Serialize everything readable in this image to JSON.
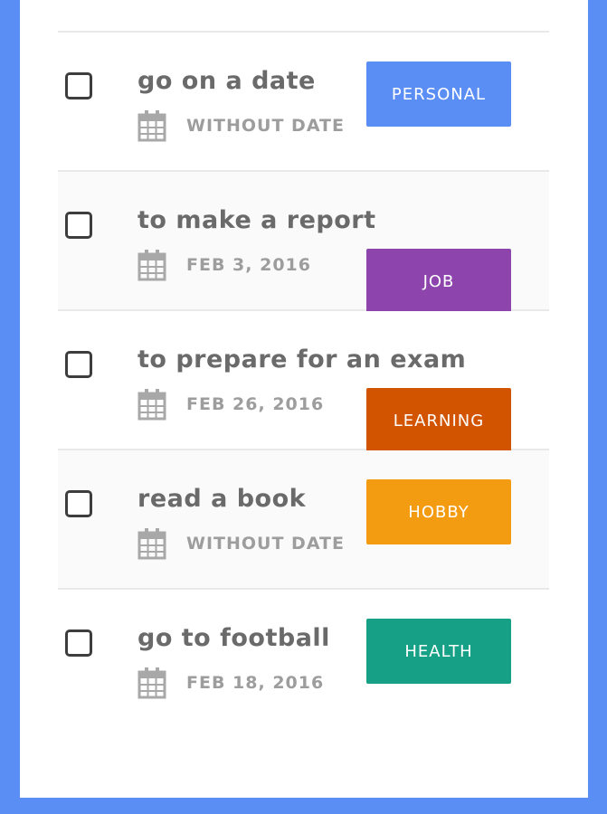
{
  "todos": [
    {
      "title": "go on a date",
      "date": "WITHOUT DATE",
      "tag": "PERSONAL",
      "tag_color": "#5b8ef5",
      "done": false
    },
    {
      "title": "to make a report",
      "date": "FEB 3, 2016",
      "tag": "JOB",
      "tag_color": "#8e44ad",
      "done": false
    },
    {
      "title": "to prepare for an exam",
      "date": "FEB 26, 2016",
      "tag": "LEARNING",
      "tag_color": "#d35400",
      "done": false
    },
    {
      "title": "read a book",
      "date": "WITHOUT DATE",
      "tag": "HOBBY",
      "tag_color": "#f39c12",
      "done": false
    },
    {
      "title": "go to football",
      "date": "FEB 18, 2016",
      "tag": "HEALTH",
      "tag_color": "#16a085",
      "done": false
    }
  ],
  "colors": {
    "frame_accent": "#5b8ef5",
    "title_text": "#6a6a6a",
    "date_text": "#9d9d9d",
    "icon": "#a8a8a8"
  },
  "icons": {
    "checkbox": "checkbox-icon",
    "date": "calendar-icon"
  }
}
